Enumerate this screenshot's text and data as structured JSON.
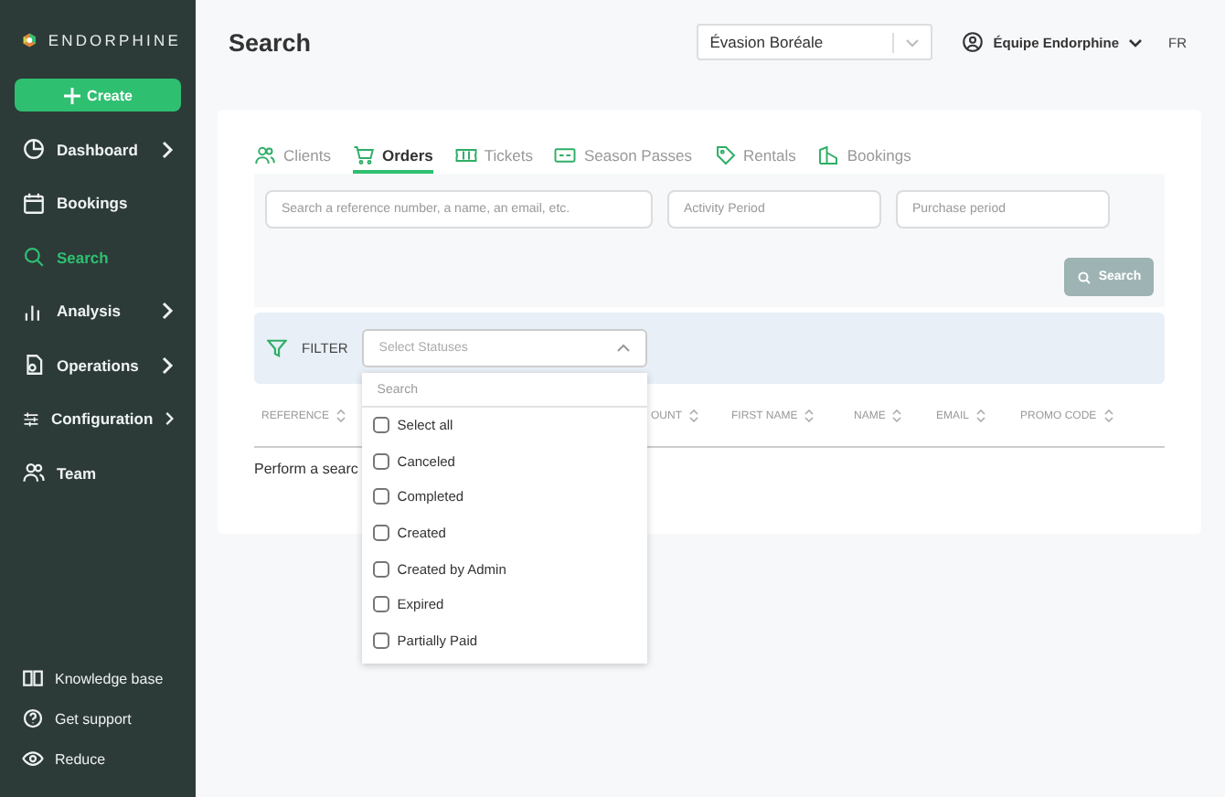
{
  "sidebar": {
    "logo": "ENDORPHINE",
    "create_button": "Create",
    "items": [
      {
        "label": "Dashboard",
        "selected": false,
        "expandable": true
      },
      {
        "label": "Bookings",
        "selected": false,
        "expandable": false
      },
      {
        "label": "Search",
        "selected": true,
        "expandable": false
      },
      {
        "label": "Analysis",
        "selected": false,
        "expandable": true
      },
      {
        "label": "Operations",
        "selected": false,
        "expandable": true
      },
      {
        "label": "Configuration",
        "selected": false,
        "expandable": true
      },
      {
        "label": "Team",
        "selected": false,
        "expandable": false
      }
    ],
    "footer": [
      {
        "label": "Knowledge base"
      },
      {
        "label": "Get support"
      },
      {
        "label": "Reduce"
      }
    ]
  },
  "header": {
    "title": "Search",
    "organization": "Évasion Boréale",
    "user": "Équipe Endorphine",
    "language": "FR"
  },
  "tabs": [
    {
      "label": "Clients",
      "selected": false
    },
    {
      "label": "Orders",
      "selected": true
    },
    {
      "label": "Tickets",
      "selected": false
    },
    {
      "label": "Season Passes",
      "selected": false
    },
    {
      "label": "Rentals",
      "selected": false
    },
    {
      "label": "Bookings",
      "selected": false
    }
  ],
  "fields": [
    {
      "placeholder": "Search a reference number, a name, an email, etc."
    },
    {
      "placeholder": "Activity Period"
    },
    {
      "placeholder": "Purchase period"
    }
  ],
  "search_button": {
    "label": "Search",
    "disabled": true
  },
  "filter": {
    "label": "FILTER",
    "select_placeholder": "Select Statuses",
    "expanded": true,
    "dropdown": {
      "search_placeholder": "Search",
      "options": [
        {
          "label": "Select all",
          "checked": false
        },
        {
          "label": "Canceled",
          "checked": false
        },
        {
          "label": "Completed",
          "checked": false
        },
        {
          "label": "Created",
          "checked": false
        },
        {
          "label": "Created by Admin",
          "checked": false
        },
        {
          "label": "Expired",
          "checked": false
        },
        {
          "label": "Partially Paid",
          "checked": false
        }
      ]
    }
  },
  "table": {
    "columns": [
      "REFERENCE",
      "OUNT",
      "FIRST NAME",
      "NAME",
      "EMAIL",
      "PROMO CODE"
    ],
    "empty_message": "Perform a searc"
  }
}
